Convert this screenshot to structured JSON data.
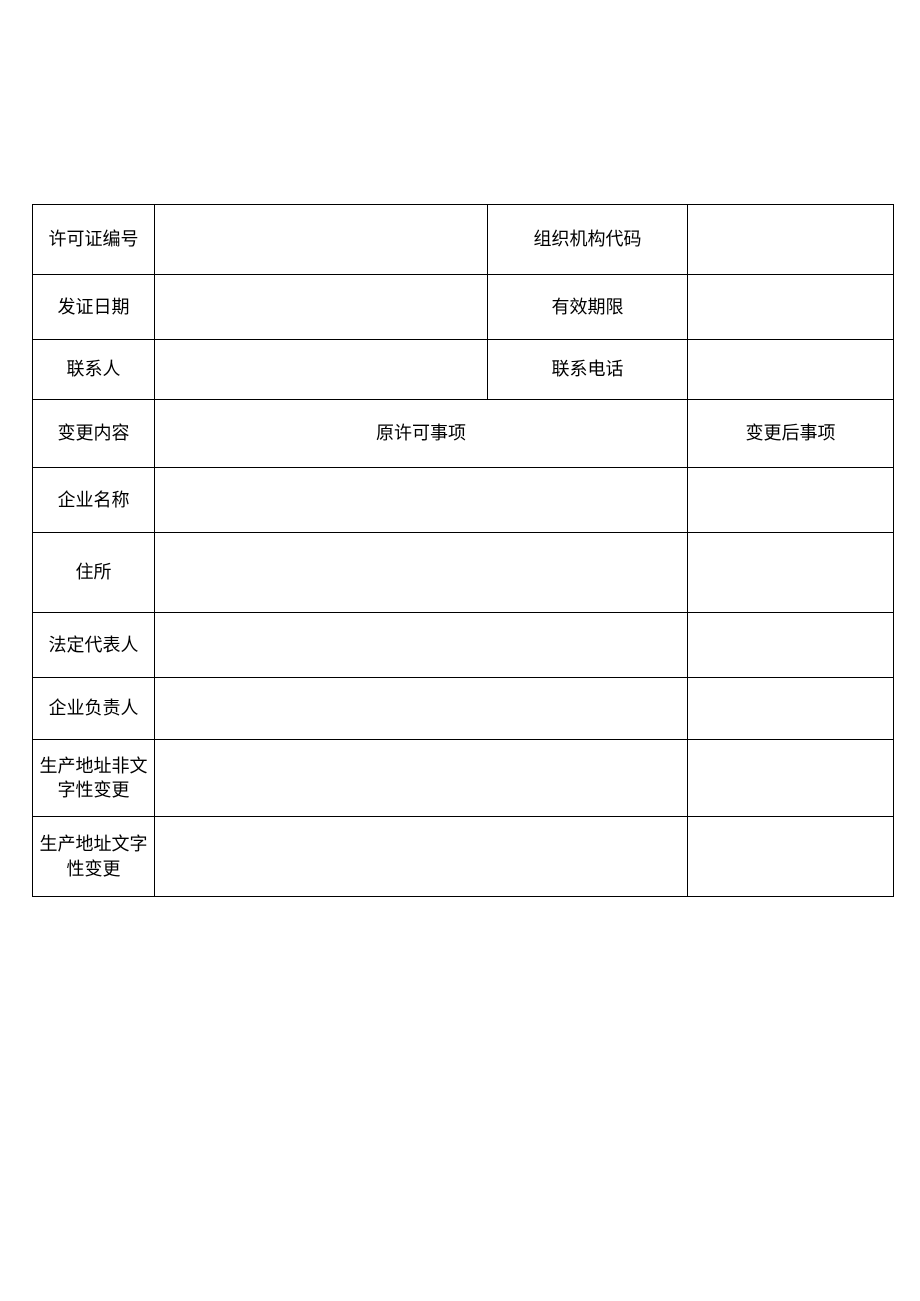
{
  "labels": {
    "license_no": "许可证编号",
    "org_code": "组织机构代码",
    "issue_date": "发证日期",
    "valid_until": "有效期限",
    "contact_person": "联系人",
    "contact_phone": "联系电话",
    "change_content": "变更内容",
    "original_item": "原许可事项",
    "after_change_item": "变更后事项",
    "enterprise_name": "企业名称",
    "residence": "住所",
    "legal_rep": "法定代表人",
    "enterprise_principal": "企业负责人",
    "prod_addr_nontext": "生产地址非文字性变更",
    "prod_addr_text": "生产地址文字性变更"
  },
  "values": {
    "license_no": "",
    "org_code": "",
    "issue_date": "",
    "valid_until": "",
    "contact_person": "",
    "contact_phone": "",
    "enterprise_name_before": "",
    "enterprise_name_after": "",
    "residence_before": "",
    "residence_after": "",
    "legal_rep_before": "",
    "legal_rep_after": "",
    "enterprise_principal_before": "",
    "enterprise_principal_after": "",
    "prod_addr_nontext_before": "",
    "prod_addr_nontext_after": "",
    "prod_addr_text_before": "",
    "prod_addr_text_after": ""
  }
}
